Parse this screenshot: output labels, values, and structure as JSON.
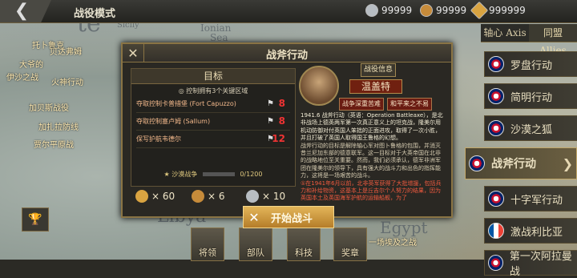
{
  "header": {
    "title": "战役模式",
    "back_icon": "chevron-left-icon"
  },
  "resources": [
    {
      "icon": "silver-medal-icon",
      "value": "99999"
    },
    {
      "icon": "bronze-medal-icon",
      "value": "99999"
    },
    {
      "icon": "sun-badge-icon",
      "value": "999999"
    }
  ],
  "faction_tabs": [
    "轴心 Axis",
    "同盟 Allies"
  ],
  "map_labels": [
    "Sicily",
    "Ionian",
    "Sea",
    "Libya",
    "Egypt",
    "te"
  ],
  "left_map_items": [
    "托卜鲁克",
    "贝达弗姆",
    "大爷的",
    "伊沙之战",
    "火神行动",
    "加贝斯战役",
    "加扎拉防线",
    "贾尔平原战",
    "马特鲁港战役",
    "决堤行动"
  ],
  "side_list": [
    {
      "label": "罗盘行动"
    },
    {
      "label": "简明行动"
    },
    {
      "label": "沙漠之狐"
    },
    {
      "label": "战斧行动",
      "selected": true
    },
    {
      "label": "十字军行动"
    },
    {
      "label": "激战利比亚"
    },
    {
      "label": "第一次阿拉曼战"
    }
  ],
  "dialog": {
    "title": "战斧行动",
    "objectives_title": "目标",
    "objectives_sub": "控制拥有3个关键区域",
    "objectives": [
      {
        "text": "夺取控制卡普措堡 (Fort Capuzzo)",
        "value": "8"
      },
      {
        "text": "夺取控制塞卢姆 (Sallum)",
        "value": "8"
      },
      {
        "text": "保写护航韦德尔",
        "value": "12"
      }
    ],
    "progress_label": "沙漠战争",
    "progress_value": "0/1200",
    "rewards": [
      {
        "icon": "sun-medal-icon",
        "value": "× 60",
        "color": "#d9a441"
      },
      {
        "icon": "bronze-medal-icon",
        "value": "× 6",
        "color": "#c68b3a"
      },
      {
        "icon": "silver-medal-icon",
        "value": "× 10",
        "color": "#b7bdc2"
      }
    ],
    "info_button": "战役信息",
    "commander": "温盖特",
    "traits": [
      "战争深重苦难",
      "和平来之不易"
    ],
    "desc_year": "1941.6",
    "desc_lead": " 战斧行动（英语：Operation Battleaxe），是北非战场上德英两军第一次真正意义上的坦克战，隆美尔用机动防御对付英国人笨拙的正面进攻，取得了一次小胜，并且打破了英国人取得国王鲁格的幻想。",
    "desc_body": "战斧行动的目标是解除轴心军对图卜鲁格的包围，并消灭昔兰尼加东部的德意联军。这一目标对于大英帝国在北非的战略地位至关重要。然而，我们必须承认，德军非洲军团在隆美尔的领导下，具有强大的战斗力和出色的指挥能力，这将是一场艰苦的战斗。",
    "desc_red": "①在1941年6月以前，北非英军获得了大批增援，包括兵力和补给物资，这基本上是丘吉尔个人努力的结果，因为英国本土及英国海军护航的运输船舰，为了"
  },
  "start_button": "开始战斗",
  "bottom_tabs": [
    "将领",
    "部队",
    "科技",
    "奖章"
  ],
  "bottom_partial": "一场埃及之战"
}
